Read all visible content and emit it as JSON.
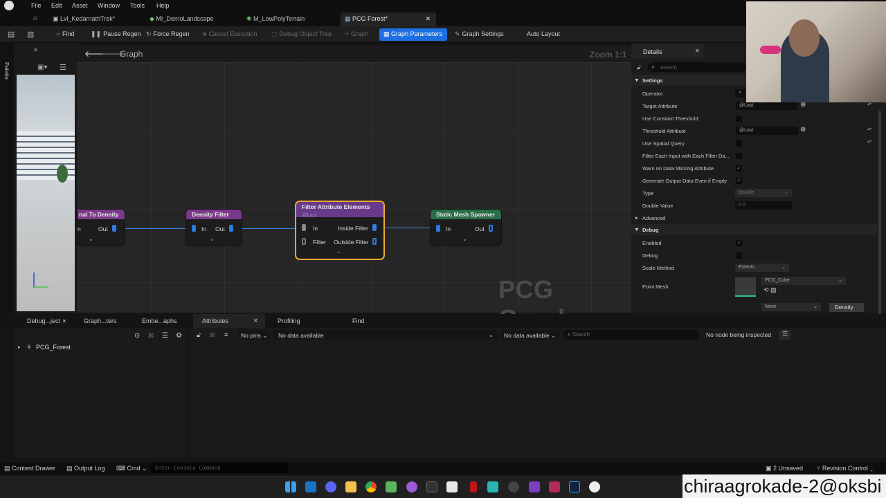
{
  "menu": [
    "File",
    "Edit",
    "Asset",
    "Window",
    "Tools",
    "Help"
  ],
  "tabs": [
    {
      "label": "Lvl_KedarnathTrek*"
    },
    {
      "label": "MI_DemoLandscape"
    },
    {
      "label": "M_LowPolyTerrain"
    },
    {
      "label": "PCG Forest*"
    }
  ],
  "toolbar": {
    "find": "Find",
    "pause": "Pause Regen",
    "force": "Force Regen",
    "cancel": "Cancel Execution",
    "debug_tree": "Debug Object Tree",
    "graph": "Graph",
    "graph_params": "Graph Parameters",
    "graph_settings": "Graph Settings",
    "auto_layout": "Auto Layout"
  },
  "left": {
    "palette": "Palette"
  },
  "graph": {
    "title": "Graph",
    "zoom": "Zoom 1:1",
    "watermark": "PCG Graph",
    "nodes": {
      "n1": {
        "title": "nal To Density",
        "out": "Out",
        "in": "n"
      },
      "n2": {
        "title": "Density Filter",
        "in": "In",
        "out": "Out"
      },
      "n3": {
        "title": "Filter Attribute Elements",
        "sub": "@Last",
        "in": "In",
        "filter": "Filter",
        "inside": "Inside Filter",
        "outside": "Outside Filter"
      },
      "n4": {
        "title": "Static Mesh Spawner",
        "in": "In",
        "out": "Out"
      }
    }
  },
  "details": {
    "title": "Details",
    "search_placeholder": "Search",
    "settings": "Settings",
    "rows": {
      "operator": "Operator",
      "operator_val": ">",
      "target": "Target Attribute",
      "target_val": "@Last",
      "use_const": "Use Constant Threshold",
      "threshold": "Threshold Attribute",
      "threshold_val": "@Last",
      "spatial": "Use Spatial Query",
      "filter_each": "Filter Each Input with Each Filter Da...",
      "warn": "Warn on Data Missing Attribute",
      "gen_output": "Generate Output Data Even if Empty",
      "type": "Type",
      "type_val": "Double",
      "double": "Double Value",
      "double_val": "0.0"
    },
    "advanced": "Advanced",
    "debug": "Debug",
    "debug_rows": {
      "enabled": "Enabled",
      "debug": "Debug",
      "scale": "Scale Method",
      "scale_val": "Extents",
      "mesh": "Point Mesh",
      "mesh_val": "PCG_Cube",
      "none": "None",
      "density": "Density"
    }
  },
  "bottom": {
    "tabs": [
      "Debug...ject",
      "Graph...ters",
      "Embe...aphs",
      "Attributes",
      "Profiling",
      "Find"
    ],
    "tree_item": "PCG_Forest",
    "pins": "No pins",
    "data1": "No data available",
    "data2": "No data available",
    "search": "Search",
    "inspected": "No node being inspected"
  },
  "status": {
    "content_drawer": "Content Drawer",
    "output_log": "Output Log",
    "cmd": "Cmd",
    "console_placeholder": "Enter Console Command",
    "unsaved": "2 Unsaved",
    "revision": "Revision Control"
  },
  "overlay": "chiraagrokade-2@oksbi"
}
